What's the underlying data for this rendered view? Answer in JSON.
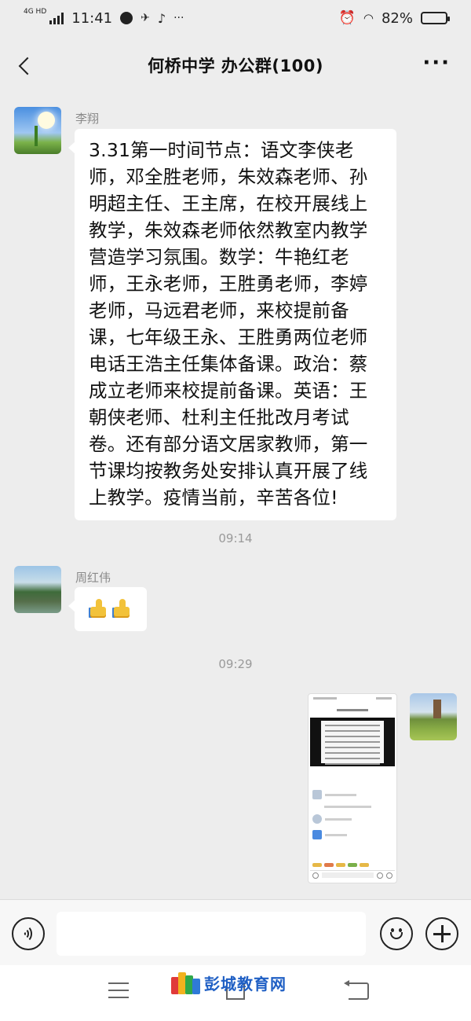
{
  "status_bar": {
    "network": "4G HD",
    "time": "11:41",
    "battery_percent": "82%",
    "battery_level": 0.82
  },
  "header": {
    "title": "何桥中学  办公群(100)",
    "back_icon": "chevron-left-icon",
    "more_label": "···"
  },
  "messages": [
    {
      "sender": "李翔",
      "type": "text",
      "text": "3.31第一时间节点：语文李侠老师，邓全胜老师，朱效森老师、孙明超主任、王主席，在校开展线上教学，朱效森老师依然教室内教学营造学习氛围。数学：牛艳红老师，王永老师，王胜勇老师，李婷老师，马远君老师，来校提前备课，七年级王永、王胜勇两位老师电话王浩主任集体备课。政治：蔡成立老师来校提前备课。英语：王朝侠老师、杜利主任批改月考试卷。还有部分语文居家教师，第一节课均按教务处安排认真开展了线上教学。疫情当前，辛苦各位!"
    },
    {
      "timestamp": "09:14"
    },
    {
      "sender": "周红伟",
      "type": "emoji",
      "emoji": [
        "thumbs-up-icon",
        "thumbs-up-icon"
      ]
    },
    {
      "timestamp": "09:29"
    },
    {
      "sender": "",
      "type": "image",
      "image": "chat-screenshot-image"
    }
  ],
  "input_bar": {
    "voice_icon": "voice-icon",
    "emoji_icon": "emoji-icon",
    "plus_icon": "plus-icon",
    "value": ""
  },
  "watermark": {
    "text": "彭城教育网"
  },
  "colors": {
    "background": "#ededed",
    "bubble_left": "#ffffff",
    "watermark_blue": "#1f5fc4"
  }
}
